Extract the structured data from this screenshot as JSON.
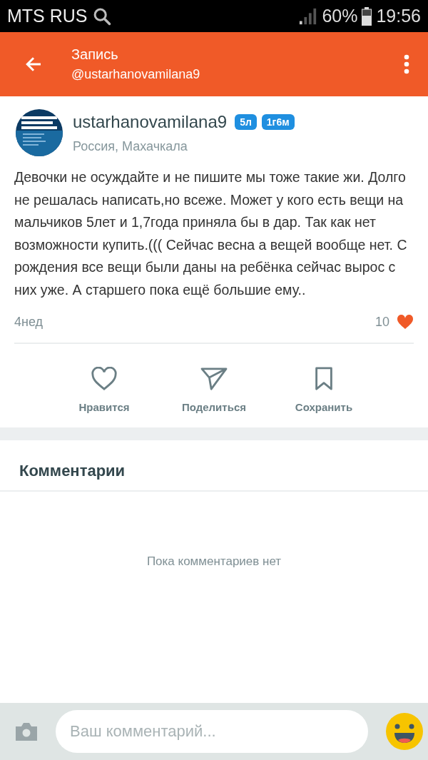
{
  "status_bar": {
    "carrier": "MTS RUS",
    "battery": "60%",
    "time": "19:56"
  },
  "header": {
    "title": "Запись",
    "subtitle": "@ustarhanovamilana9"
  },
  "post": {
    "author": "ustarhanovamilana9",
    "badges": [
      "5л",
      "1г6м"
    ],
    "location": "Россия, Махачкала",
    "text": "Девочки не осуждайте и не пишите мы тоже такие жи. Долго не решалась написать,но всеже. Может у кого есть вещи на мальчиков 5лет и 1,7года приняла бы в дар. Так как нет возможности купить.(((  Сейчас весна а вещей вообще нет. С рождения все вещи были даны на ребёнка сейчас вырос с них уже. А старшего пока ещё большие ему..",
    "age": "4нед",
    "likes": "10"
  },
  "actions": [
    {
      "kind": "like",
      "label": "Нравится"
    },
    {
      "kind": "share",
      "label": "Поделиться"
    },
    {
      "kind": "save",
      "label": "Сохранить"
    }
  ],
  "comments": {
    "title": "Комментарии",
    "empty": "Пока комментариев нет"
  },
  "composer": {
    "placeholder": "Ваш комментарий..."
  }
}
